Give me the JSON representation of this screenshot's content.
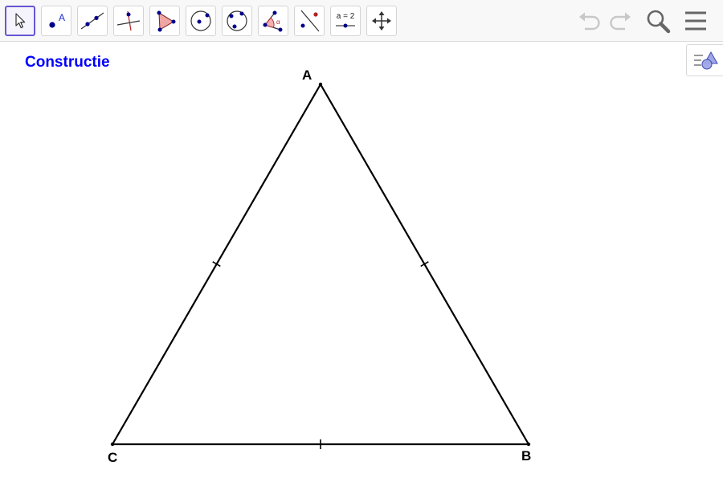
{
  "toolbar": {
    "tools": [
      {
        "name": "move",
        "active": true
      },
      {
        "name": "point",
        "icon_label": "A"
      },
      {
        "name": "line"
      },
      {
        "name": "perpendicular-line"
      },
      {
        "name": "polygon"
      },
      {
        "name": "circle-center-point"
      },
      {
        "name": "circle-three-points"
      },
      {
        "name": "angle",
        "icon_label": "α"
      },
      {
        "name": "reflect-about-line"
      },
      {
        "name": "slider",
        "icon_label": "a = 2"
      },
      {
        "name": "move-graphics-view"
      }
    ],
    "header_buttons": [
      "undo-icon",
      "redo-icon",
      "search-icon",
      "menu-icon"
    ]
  },
  "graphics": {
    "title": "Constructie",
    "title_color": "#0000ff",
    "style_bar_icon": "style-bar-toggle-icon",
    "points": {
      "A": {
        "label": "A"
      },
      "B": {
        "label": "B"
      },
      "C": {
        "label": "C"
      }
    },
    "segments": [
      "AB",
      "BC",
      "CA"
    ],
    "equal_length_marks": true
  },
  "colors": {
    "accent": "#6557d2",
    "point": "#00008b",
    "line": "#000000",
    "disabled_icon": "#c8c8c8"
  }
}
